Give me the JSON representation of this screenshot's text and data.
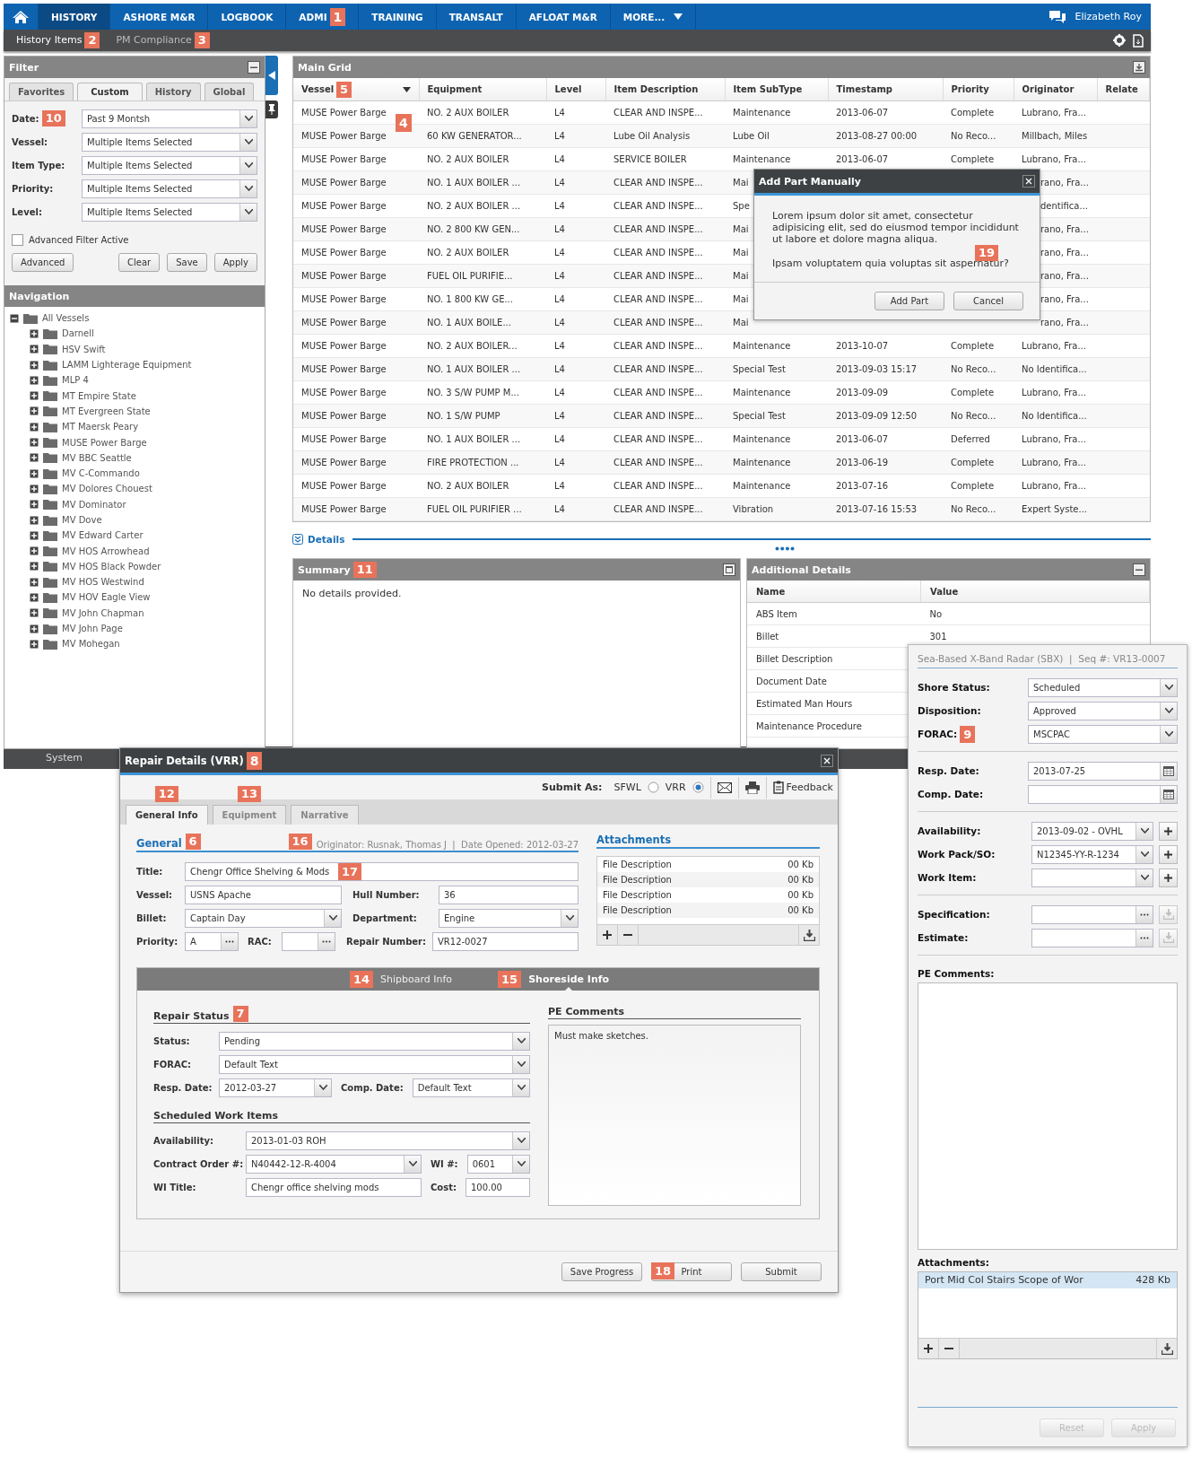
{
  "top_nav": {
    "tabs": [
      {
        "label": "HISTORY",
        "selected": true
      },
      {
        "label": "ASHORE M&R",
        "selected": false
      },
      {
        "label": "LOGBOOK",
        "selected": false
      },
      {
        "label": "ADMI",
        "selected": false,
        "badge": "1"
      },
      {
        "label": "TRAINING",
        "selected": false
      },
      {
        "label": "TRANSALT",
        "selected": false
      },
      {
        "label": "AFLOAT M&R",
        "selected": false
      },
      {
        "label": "MORE...",
        "selected": false,
        "kind": "menu"
      }
    ],
    "user": "Elizabeth Roy"
  },
  "sub_nav": {
    "items": [
      {
        "label": "History Items",
        "selected": true,
        "badge": "2"
      },
      {
        "label": "PM Compliance",
        "selected": false,
        "badge": "3"
      }
    ]
  },
  "filter": {
    "title": "Filter",
    "tabs": [
      {
        "label": "Favorites",
        "selected": false
      },
      {
        "label": "Custom",
        "selected": true
      },
      {
        "label": "History",
        "selected": false
      },
      {
        "label": "Global",
        "selected": false
      }
    ],
    "fields": [
      {
        "label": "Date:",
        "value": "Past 9 Montsh",
        "badge": "10"
      },
      {
        "label": "Vessel:",
        "value": "Multiple Items Selected"
      },
      {
        "label": "Item Type:",
        "value": "Multiple Items Selected"
      },
      {
        "label": "Priority:",
        "value": "Multiple Items Selected"
      },
      {
        "label": "Level:",
        "value": "Multiple Items Selected"
      }
    ],
    "advanced_filter": {
      "label": "Advanced Filter Active",
      "checked": false
    },
    "buttons": [
      "Advanced",
      "Clear",
      "Save",
      "Apply"
    ]
  },
  "navigation": {
    "title": "Navigation",
    "tree": [
      {
        "label": "All Vessels",
        "expanded": true,
        "children": [
          {
            "label": "Darnell",
            "expanded": false
          },
          {
            "label": "HSV Swift",
            "expanded": false
          },
          {
            "label": "LAMM Lighterage Equipment",
            "expanded": false
          },
          {
            "label": "MLP 4",
            "expanded": false
          },
          {
            "label": "MT Empire State",
            "expanded": false
          },
          {
            "label": "MT Evergreen State",
            "expanded": false
          },
          {
            "label": "MT Maersk Peary",
            "expanded": false
          },
          {
            "label": "MUSE Power Barge",
            "expanded": false
          },
          {
            "label": "MV BBC Seattle",
            "expanded": false
          },
          {
            "label": "MV C-Commando",
            "expanded": false
          },
          {
            "label": "MV Dolores Chouest",
            "expanded": false
          },
          {
            "label": "MV Dominator",
            "expanded": false
          },
          {
            "label": "MV Dove",
            "expanded": false
          },
          {
            "label": "MV Edward Carter",
            "expanded": false
          },
          {
            "label": "MV HOS Arrowhead",
            "expanded": false
          },
          {
            "label": "MV HOS Black Powder",
            "expanded": false
          },
          {
            "label": "MV HOS Westwind",
            "expanded": false
          },
          {
            "label": "MV HOV Eagle View",
            "expanded": false
          },
          {
            "label": "MV John Chapman",
            "expanded": false
          },
          {
            "label": "MV John Page",
            "expanded": false
          },
          {
            "label": "MV Mohegan",
            "expanded": false
          }
        ]
      }
    ]
  },
  "system_bar": {
    "label": "System"
  },
  "main_grid": {
    "title": "Main Grid",
    "badge": "4",
    "columns": [
      {
        "label": "Vessel",
        "badge": "5",
        "sorted": true
      },
      {
        "label": "Equipment",
        "sorted": false
      },
      {
        "label": "Level",
        "sorted": false
      },
      {
        "label": "Item Description",
        "sorted": false
      },
      {
        "label": "Item SubType",
        "sorted": false
      },
      {
        "label": "Timestamp",
        "sorted": false
      },
      {
        "label": "Priority",
        "sorted": false
      },
      {
        "label": "Originator",
        "sorted": false
      },
      {
        "label": "Relate",
        "sorted": false
      }
    ],
    "rows": [
      {
        "vessel": "MUSE Power Barge",
        "equipment": "NO. 2 AUX BOILER",
        "level": "L4",
        "description": "CLEAR AND INSPE...",
        "subtype": "Maintenance",
        "timestamp": "2013-06-07",
        "priority": "Complete",
        "originator": "Lubrano, Fra..."
      },
      {
        "vessel": "MUSE Power Barge",
        "equipment": "60 KW GENERATOR...",
        "level": "L4",
        "description": "Lube Oil Analysis",
        "subtype": "Lube Oil",
        "timestamp": "2013-08-27 00:00",
        "priority": "No Reco...",
        "originator": "Millbach, Miles"
      },
      {
        "vessel": "MUSE Power Barge",
        "equipment": "NO. 2 AUX BOILER",
        "level": "L4",
        "description": "SERVICE BOILER",
        "subtype": "Maintenance",
        "timestamp": "2013-06-07",
        "priority": "Complete",
        "originator": "Lubrano, Fra..."
      },
      {
        "vessel": "MUSE Power Barge",
        "equipment": "NO. 1 AUX BOILER ...",
        "level": "L4",
        "description": "CLEAR AND INSPE...",
        "subtype": "Mai",
        "originator": "rano, Fra..."
      },
      {
        "vessel": "MUSE Power Barge",
        "equipment": "NO. 2 AUX BOILER ...",
        "level": "L4",
        "description": "CLEAR AND INSPE...",
        "subtype": "Spe",
        "originator": "dentifica..."
      },
      {
        "vessel": "MUSE Power Barge",
        "equipment": "NO. 2 800 KW GEN...",
        "level": "L4",
        "description": "CLEAR AND INSPE...",
        "subtype": "Mai",
        "originator": "rano, Fra..."
      },
      {
        "vessel": "MUSE Power Barge",
        "equipment": "NO. 2 AUX BOILER",
        "level": "L4",
        "description": "CLEAR AND INSPE...",
        "subtype": "Mai",
        "originator": "rano, Fra..."
      },
      {
        "vessel": "MUSE Power Barge",
        "equipment": "FUEL OIL PURIFIE...",
        "level": "L4",
        "description": "CLEAR AND INSPE...",
        "subtype": "Mai",
        "originator": "rano, Fra..."
      },
      {
        "vessel": "MUSE Power Barge",
        "equipment": "NO. 1 800 KW GE...",
        "level": "L4",
        "description": "CLEAR AND INSPE...",
        "subtype": "Mai",
        "originator": "rano, Fra..."
      },
      {
        "vessel": "MUSE Power Barge",
        "equipment": "NO. 1 AUX BOILE...",
        "level": "L4",
        "description": "CLEAR AND INSPE...",
        "subtype": "Mai",
        "originator": "rano, Fra..."
      },
      {
        "vessel": "MUSE Power Barge",
        "equipment": "NO. 2 AUX BOILER...",
        "level": "L4",
        "description": "CLEAR AND INSPE...",
        "subtype": "Maintenance",
        "timestamp": "2013-10-07",
        "priority": "Complete",
        "originator": "Lubrano, Fra..."
      },
      {
        "vessel": "MUSE Power Barge",
        "equipment": "NO. 1 AUX BOILER ...",
        "level": "L4",
        "description": "CLEAR AND INSPE...",
        "subtype": "Special Test",
        "timestamp": "2013-09-03 15:17",
        "priority": "No Reco...",
        "originator": "No Identifica..."
      },
      {
        "vessel": "MUSE Power Barge",
        "equipment": "NO. 3 S/W PUMP M...",
        "level": "L4",
        "description": "CLEAR AND INSPE...",
        "subtype": "Maintenance",
        "timestamp": "2013-09-09",
        "priority": "Complete",
        "originator": "Lubrano, Fra..."
      },
      {
        "vessel": "MUSE Power Barge",
        "equipment": "NO. 1 S/W PUMP",
        "level": "L4",
        "description": "CLEAR AND INSPE...",
        "subtype": "Special Test",
        "timestamp": "2013-09-09 12:50",
        "priority": "No Reco...",
        "originator": "No Identifica..."
      },
      {
        "vessel": "MUSE Power Barge",
        "equipment": "NO. 1 AUX BOILER ...",
        "level": "L4",
        "description": "CLEAR AND INSPE...",
        "subtype": "Maintenance",
        "timestamp": "2013-06-07",
        "priority": "Deferred",
        "originator": "Lubrano, Fra..."
      },
      {
        "vessel": "MUSE Power Barge",
        "equipment": "FIRE PROTECTION ...",
        "level": "L4",
        "description": "CLEAR AND INSPE...",
        "subtype": "Maintenance",
        "timestamp": "2013-06-19",
        "priority": "Complete",
        "originator": "Lubrano, Fra..."
      },
      {
        "vessel": "MUSE Power Barge",
        "equipment": "NO. 2 AUX BOILER",
        "level": "L4",
        "description": "CLEAR AND INSPE...",
        "subtype": "Maintenance",
        "timestamp": "2013-07-16",
        "priority": "Complete",
        "originator": "Lubrano, Fra..."
      },
      {
        "vessel": "MUSE Power Barge",
        "equipment": "FUEL OIL PURIFIER ...",
        "level": "L4",
        "description": "CLEAR AND INSPE...",
        "subtype": "Vibration",
        "timestamp": "2013-07-16 15:53",
        "priority": "No Reco...",
        "originator": "Expert Syste..."
      }
    ]
  },
  "details": {
    "label": "Details",
    "summary": {
      "title": "Summary",
      "badge": "11",
      "text": "No details provided."
    },
    "additional_details": {
      "title": "Additional Details",
      "columns": [
        "Name",
        "Value"
      ],
      "rows": [
        {
          "name": "ABS Item",
          "value": "No"
        },
        {
          "name": "Billet",
          "value": "301"
        },
        {
          "name": "Billet Description"
        },
        {
          "name": "Document Date"
        },
        {
          "name": "Estimated Man Hours"
        },
        {
          "name": "Maintenance Procedure"
        }
      ]
    }
  },
  "add_part_dialog": {
    "title": "Add Part Manually",
    "message": "Lorem ipsum dolor sit amet, consectetur adipisicing elit, sed do eiusmod tempor incididunt ut labore et dolore magna aliqua.",
    "badge": "19",
    "question": "Ipsam voluptatem quia voluptas sit aspernatur?",
    "buttons": [
      "Add Part",
      "Cancel"
    ]
  },
  "repair_window": {
    "title": "Repair Details (VRR)",
    "badge": "8",
    "submit_as": {
      "label": "Submit As:",
      "options": [
        {
          "label": "SFWL",
          "selected": false
        },
        {
          "label": "VRR",
          "selected": true
        }
      ]
    },
    "feedback": "Feedback",
    "tabs": [
      {
        "label": "General Info",
        "selected": true,
        "badge": "12"
      },
      {
        "label": "Equipment",
        "selected": false,
        "badge": "13"
      },
      {
        "label": "Narrative",
        "selected": false
      }
    ],
    "general": {
      "heading": "General",
      "badge": "6",
      "meta_badge": "16",
      "meta": "Originator: Rusnak, Thomas J  |  Date Opened: 2012-03-27",
      "rows": [
        [
          {
            "label": "Title:",
            "value": "Chengr Office Shelving & Mods",
            "kind": "text",
            "badge": "17"
          }
        ],
        [
          {
            "label": "Vessel:",
            "value": "USNS Apache",
            "kind": "text"
          },
          {
            "label": "Hull Number:",
            "value": "36",
            "kind": "text"
          }
        ],
        [
          {
            "label": "Billet:",
            "value": "Captain Day",
            "kind": "select"
          },
          {
            "label": "Department:",
            "value": "Engine",
            "kind": "select"
          }
        ],
        [
          {
            "label": "Priority:",
            "value": "A",
            "kind": "lookup"
          },
          {
            "label": "RAC:",
            "kind": "lookup"
          },
          {
            "label": "Repair Number:",
            "value": "VR12-0027",
            "kind": "text"
          }
        ]
      ]
    },
    "attachments": {
      "heading": "Attachments",
      "files": [
        {
          "name": "File Description",
          "size": "00 Kb"
        },
        {
          "name": "File Description",
          "size": "00 Kb"
        },
        {
          "name": "File Description",
          "size": "00 Kb"
        },
        {
          "name": "File Description",
          "size": "00 Kb"
        }
      ]
    },
    "info_tabs": [
      {
        "label": "Shipboard Info",
        "badge": "14",
        "selected": false
      },
      {
        "label": "Shoreside Info",
        "badge": "15",
        "selected": true
      }
    ],
    "repair_status": {
      "heading": "Repair Status",
      "badge": "7",
      "rows": [
        [
          {
            "label": "Status:",
            "value": "Pending",
            "kind": "select"
          }
        ],
        [
          {
            "label": "FORAC:",
            "value": "Default Text",
            "kind": "select"
          }
        ],
        [
          {
            "label": "Resp. Date:",
            "value": "2012-03-27",
            "kind": "select"
          },
          {
            "label": "Comp. Date:",
            "value": "Default Text",
            "kind": "select"
          }
        ]
      ]
    },
    "scheduled_work": {
      "heading": "Scheduled Work Items",
      "rows": [
        [
          {
            "label": "Availability:",
            "value": "2013-01-03 ROH",
            "kind": "select"
          }
        ],
        [
          {
            "label": "Contract Order #:",
            "value": "N40442-12-R-4004",
            "kind": "select"
          },
          {
            "label": "WI #:",
            "value": "0601",
            "kind": "select"
          }
        ],
        [
          {
            "label": "WI Title:",
            "value": "Chengr office shelving mods",
            "kind": "text"
          },
          {
            "label": "Cost:",
            "value": "100.00",
            "kind": "text"
          }
        ]
      ]
    },
    "pe_comments": {
      "heading": "PE Comments",
      "text": "Must make sketches."
    },
    "buttons": [
      {
        "label": "Save Progress"
      },
      {
        "label": "Print",
        "badge": "18"
      },
      {
        "label": "Submit"
      }
    ]
  },
  "side_panel": {
    "header": "Sea-Based X-Band Radar (SBX)  |  Seq #: VR13-0007",
    "groups": [
      [
        {
          "label": "Shore Status:",
          "value": "Scheduled",
          "kind": "select"
        },
        {
          "label": "Disposition:",
          "value": "Approved",
          "kind": "select"
        },
        {
          "label": "FORAC:",
          "value": "MSCPAC",
          "kind": "select",
          "badge": "9"
        }
      ],
      [
        {
          "label": "Resp. Date:",
          "value": "2013-07-25",
          "kind": "date"
        },
        {
          "label": "Comp. Date:",
          "kind": "date"
        }
      ],
      [
        {
          "label": "Availability:",
          "value": "2013-09-02 - OVHL",
          "kind": "select_add"
        },
        {
          "label": "Work Pack/SO:",
          "value": "N12345-YY-R-1234",
          "kind": "select_add"
        },
        {
          "label": "Work Item:",
          "kind": "select_add"
        }
      ],
      [
        {
          "label": "Specification:",
          "kind": "lookup_download"
        },
        {
          "label": "Estimate:",
          "kind": "lookup_download"
        }
      ]
    ],
    "pe_comments_label": "PE Comments:",
    "attachments_label": "Attachments:",
    "files": [
      {
        "name": "Port Mid Col Stairs Scope of Wor",
        "size": "428 Kb",
        "selected": true
      }
    ],
    "buttons": [
      {
        "label": "Reset",
        "disabled": true
      },
      {
        "label": "Apply",
        "disabled": true
      }
    ]
  }
}
